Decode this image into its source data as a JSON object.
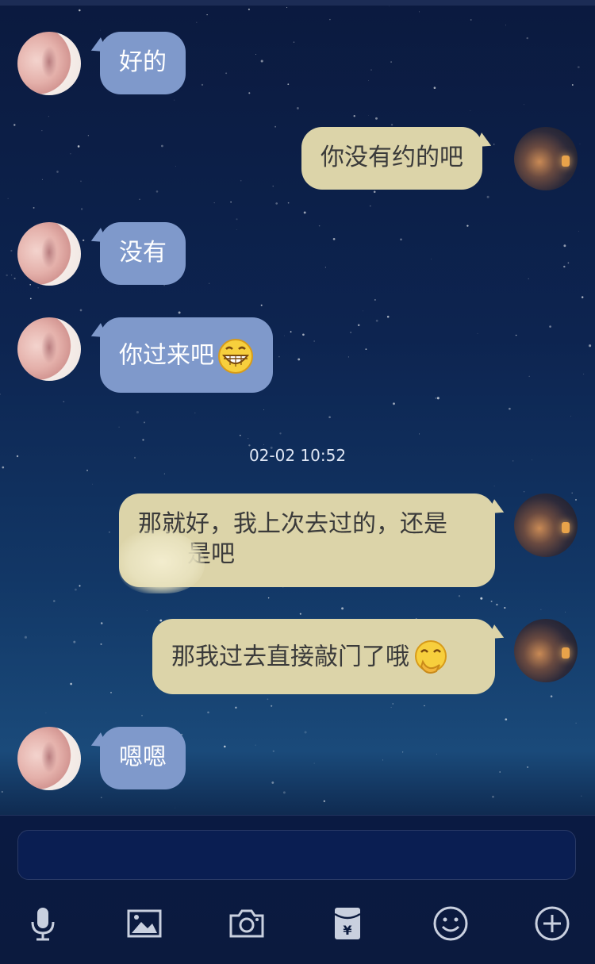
{
  "chat": {
    "timestamp": "02-02 10:52",
    "messages": [
      {
        "from": "contact",
        "text": "好的"
      },
      {
        "from": "me",
        "text": "你没有约的吧"
      },
      {
        "from": "contact",
        "text": "没有"
      },
      {
        "from": "contact",
        "text": "你过来吧",
        "emoji": "grinning-face"
      },
      {
        "from": "me",
        "text_line1": "那就好，我上次去过的，还是",
        "text_line2": "是吧",
        "note": "partially scribbled out"
      },
      {
        "from": "me",
        "text": "那我过去直接敲门了哦",
        "emoji": "hand-over-mouth-face"
      },
      {
        "from": "contact",
        "text": "嗯嗯"
      }
    ]
  },
  "composer": {
    "input_value": "",
    "input_placeholder": ""
  },
  "toolbar": {
    "icons": [
      "microphone-icon",
      "image-icon",
      "camera-icon",
      "red-packet-icon",
      "emoji-icon",
      "plus-icon"
    ]
  },
  "colors": {
    "contact_bubble": "#7f99cb",
    "my_bubble": "#dcd4a9",
    "toolbar_icon": "#c9d0df"
  }
}
